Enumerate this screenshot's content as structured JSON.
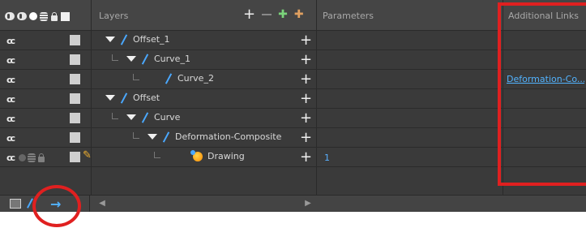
{
  "header": {
    "layers_title": "Layers",
    "parameters_title": "Parameters",
    "additional_links_title": "Additional Links"
  },
  "rows": [
    {
      "name": "Offset_1",
      "indent": 0,
      "expanded": true,
      "icon": "curve-icon",
      "param": "",
      "link": ""
    },
    {
      "name": "Curve_1",
      "indent": 1,
      "expanded": true,
      "icon": "curve-icon",
      "param": "",
      "link": ""
    },
    {
      "name": "Curve_2",
      "indent": 2,
      "expanded": false,
      "icon": "curve-icon",
      "param": "",
      "link": "Deformation-Co..."
    },
    {
      "name": "Offset",
      "indent": 0,
      "expanded": true,
      "icon": "curve-icon",
      "param": "",
      "link": ""
    },
    {
      "name": "Curve",
      "indent": 1,
      "expanded": true,
      "icon": "curve-icon",
      "param": "",
      "link": ""
    },
    {
      "name": "Deformation-Composite",
      "indent": 2,
      "expanded": true,
      "icon": "curve-icon",
      "param": "",
      "link": ""
    },
    {
      "name": "Drawing",
      "indent": 3,
      "expanded": false,
      "icon": "drawing-icon",
      "param": "1",
      "link": ""
    }
  ],
  "colors": {
    "highlight": "#e02020",
    "link": "#52b3ff",
    "panel_bg": "#3a3a3a"
  }
}
